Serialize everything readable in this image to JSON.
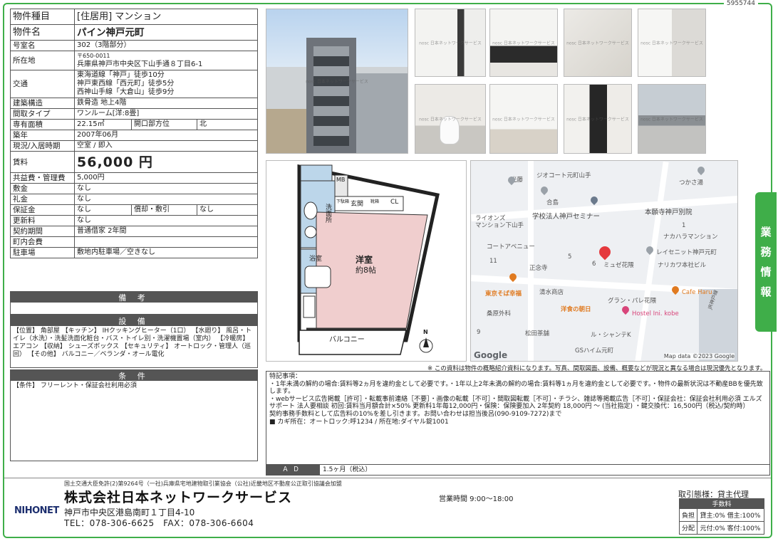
{
  "doc_id": "5955744",
  "spec": {
    "type_label": "物件種目",
    "type_value": "[住居用] マンション",
    "name_label": "物件名",
    "name_value": "パイン神戸元町",
    "room_label": "号室名",
    "room_value": "302（3階部分）",
    "address_label": "所在地",
    "postal": "〒650-0011",
    "address_value": "兵庫県神戸市中央区下山手通８丁目6-1",
    "access_label": "交通",
    "access_lines": [
      "東海道線「神戸」徒歩10分",
      "神戸東西線「西元町」徒歩5分",
      "西神山手線「大倉山」徒歩9分"
    ],
    "structure_label": "建築構造",
    "structure_value": "鉄骨造 地上4階",
    "layout_label": "間取タイプ",
    "layout_value": "ワンルーム[洋:8畳]",
    "area_label": "専有面積",
    "area_value": "22.15㎡",
    "facing_label": "開口部方位",
    "facing_value": "北",
    "built_label": "築年",
    "built_value": "2007年06月",
    "status_label": "現況/入居時期",
    "status_value": "空室 / 即入",
    "rent_label": "賃料",
    "rent_value": "56,000 円",
    "fee_label": "共益費・管理費",
    "fee_value": "5,000円",
    "deposit_label": "敷金",
    "deposit_value": "なし",
    "keymoney_label": "礼金",
    "keymoney_value": "なし",
    "security_label": "保証金",
    "security_value": "なし",
    "amort_label": "償却・敷引",
    "amort_value": "なし",
    "renewal_label": "更新料",
    "renewal_value": "なし",
    "contract_label": "契約期間",
    "contract_value": "普通借家 2年間",
    "assoc_label": "町内会費",
    "assoc_value": "",
    "parking_label": "駐車場",
    "parking_value": "敷地内駐車場／空きなし"
  },
  "sections": {
    "biko_title": "備 考",
    "biko_text": "",
    "setsubi_title": "設 備",
    "setsubi_text": "【位置】 角部屋 【キッチン】 IHクッキングヒーター（1口） 【水廻り】 風呂・トイレ（水洗）・洗髪洗面化粧台・バス・トイレ別・洗濯機置場（室内） 【冷暖房】 エアコン 【収納】 シューズボックス 【セキュリティ】 オートロック・管理人（巡回） 【その他】 バルコニー／ベランダ・オール電化",
    "joken_title": "条 件",
    "joken_text": "【条件】 フリーレント・保証会社利用必須"
  },
  "photo_watermark": "nosc 日本ネットワークサービス",
  "plan": {
    "room": "洋室",
    "room_size": "約8帖",
    "wash": "洗面所",
    "bath": "浴室",
    "genkan": "玄関",
    "shoes": "靴箱",
    "cl": "CL",
    "mb": "MB",
    "toilet": "下駄箱",
    "balcony": "バルコニー",
    "north": "N"
  },
  "map": {
    "labels": [
      "光藤",
      "ジオコート元町山手",
      "つかさ湯",
      "合島",
      "学校法人神戸セミナー",
      "本願寺神戸別院",
      "ライオンズ",
      "マンション下山手",
      "1",
      "ナカハラマンション",
      "コートアベニュー",
      "5",
      "6",
      "レイセニット神戸元町",
      "11",
      "正念寺",
      "ミュゼ花隈",
      "ナリカワ本社ビル",
      "東京そば幸福",
      "清水商店",
      "グラン・パレ花隈",
      "Cafe Haru",
      "洋食の朝日",
      "Hostel Ini. kobe",
      "桑原外科",
      "松田茶舗",
      "ル・シャンテK",
      "GSハイム元町",
      "9",
      "JR神戸線"
    ],
    "google": "Google",
    "attribution": "Map data ©2023 Google"
  },
  "tab_text": [
    "業",
    "務",
    "情",
    "報"
  ],
  "notice": "※ この資料は物件の概略紹介資料になります。写真、間取図面、設備、概要などが現況と異なる場合は現況優先となります。",
  "remarks_lines": [
    "特記事項：",
    "・1年未満の解約の場合:賃料等2ヵ月を違約金として必要です。・1年以上2年未満の解約の場合:賃料等1ヵ月を違約金として必要です。・物件の最新状況は不動産BBを優先致します。",
    "・webサービス広告掲載［許可］・転載事前連絡［不要］・画像の転載［不可］・間取図転載［不可］・チラシ、雑誌等掲載広告［不可］・保証会社：保証会社利用必須 エルズサポート 法人要相談 初回:賃料当月額合計×50% 更新料1年毎12,000円・保険：保険要加入 2年契約 18,000円 ～ (当社指定) ・鍵交換代：16,500円（税込/契約時）",
    "契約事務手数料として広告料の10%を差し引きます。お問い合わせは担当後呂(090-9109-7272)まで",
    "■ カギ所在：オートロック:呼1234 / 所在地:ダイヤル錠1001"
  ],
  "ad": {
    "label": "ＡＤ",
    "value": "1.5ヶ月（税込）"
  },
  "footer": {
    "license": "国土交通大臣免許(2)第9264号（一社)兵庫県宅地建物取引業協会（公社)近畿地区不動産公正取引協議会加盟",
    "company": "株式会社日本ネットワークサービス",
    "address": "神戸市中央区港島南町１丁目4-10",
    "tel": "TEL：078-306-6625　FAX：078-306-6604",
    "hours": "営業時間 9:00～18:00",
    "logo": "NIHONET",
    "torihiki": "取引態様：貸主代理",
    "fee_head": "手数料",
    "futan_label": "負担",
    "futan_value": "貸主:0% 借主:100%",
    "haibun_label": "分配",
    "haibun_value": "元付:0% 客付:100%"
  }
}
